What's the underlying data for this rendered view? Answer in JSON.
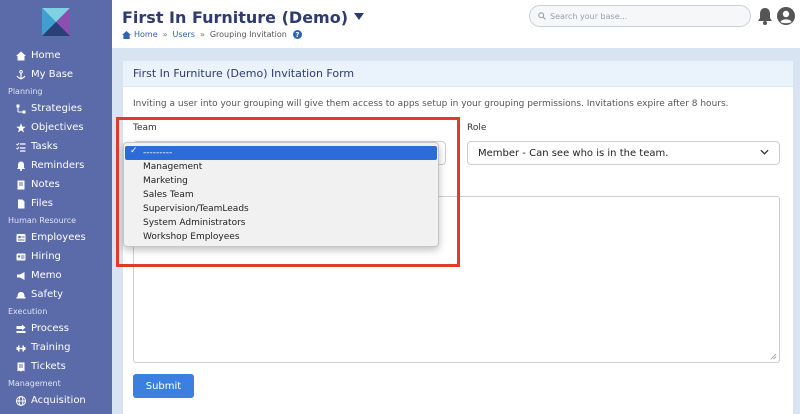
{
  "header": {
    "title": "First In Furniture (Demo)",
    "breadcrumb": [
      "Home",
      "Users",
      "Grouping Invitation"
    ],
    "search_placeholder": "Search your base..."
  },
  "sidebar": {
    "items": [
      {
        "type": "item",
        "label": "Home",
        "icon": "home-icon"
      },
      {
        "type": "item",
        "label": "My Base",
        "icon": "anchor-icon"
      },
      {
        "type": "section",
        "label": "Planning"
      },
      {
        "type": "item",
        "label": "Strategies",
        "icon": "strategies-icon"
      },
      {
        "type": "item",
        "label": "Objectives",
        "icon": "star-icon"
      },
      {
        "type": "item",
        "label": "Tasks",
        "icon": "tasks-icon"
      },
      {
        "type": "item",
        "label": "Reminders",
        "icon": "bell-icon"
      },
      {
        "type": "item",
        "label": "Notes",
        "icon": "note-icon"
      },
      {
        "type": "item",
        "label": "Files",
        "icon": "file-icon"
      },
      {
        "type": "section",
        "label": "Human Resource"
      },
      {
        "type": "item",
        "label": "Employees",
        "icon": "employees-icon"
      },
      {
        "type": "item",
        "label": "Hiring",
        "icon": "id-card-icon"
      },
      {
        "type": "item",
        "label": "Memo",
        "icon": "megaphone-icon"
      },
      {
        "type": "item",
        "label": "Safety",
        "icon": "hardhat-icon"
      },
      {
        "type": "section",
        "label": "Execution"
      },
      {
        "type": "item",
        "label": "Process",
        "icon": "process-icon"
      },
      {
        "type": "item",
        "label": "Training",
        "icon": "training-icon"
      },
      {
        "type": "item",
        "label": "Tickets",
        "icon": "ticket-icon"
      },
      {
        "type": "section",
        "label": "Management"
      },
      {
        "type": "item",
        "label": "Acquisition",
        "icon": "acquisition-icon"
      }
    ]
  },
  "form": {
    "title": "First In Furniture (Demo) Invitation Form",
    "info": "Inviting a user into your grouping will give them access to apps setup in your grouping permissions. Invitations expire after 8 hours.",
    "team_label": "Team",
    "role_label": "Role",
    "role_value": "Member - Can see who is in the team.",
    "submit_label": "Submit"
  },
  "team_dropdown": {
    "options": [
      "---------",
      "Management",
      "Marketing",
      "Sales Team",
      "Supervision/TeamLeads",
      "System Administrators",
      "Workshop Employees"
    ],
    "selected_index": 0
  },
  "colors": {
    "sidebar": "#5b6aa8",
    "accent": "#3b7fe0",
    "highlight": "#e03a2c",
    "title": "#2f3b6e"
  }
}
